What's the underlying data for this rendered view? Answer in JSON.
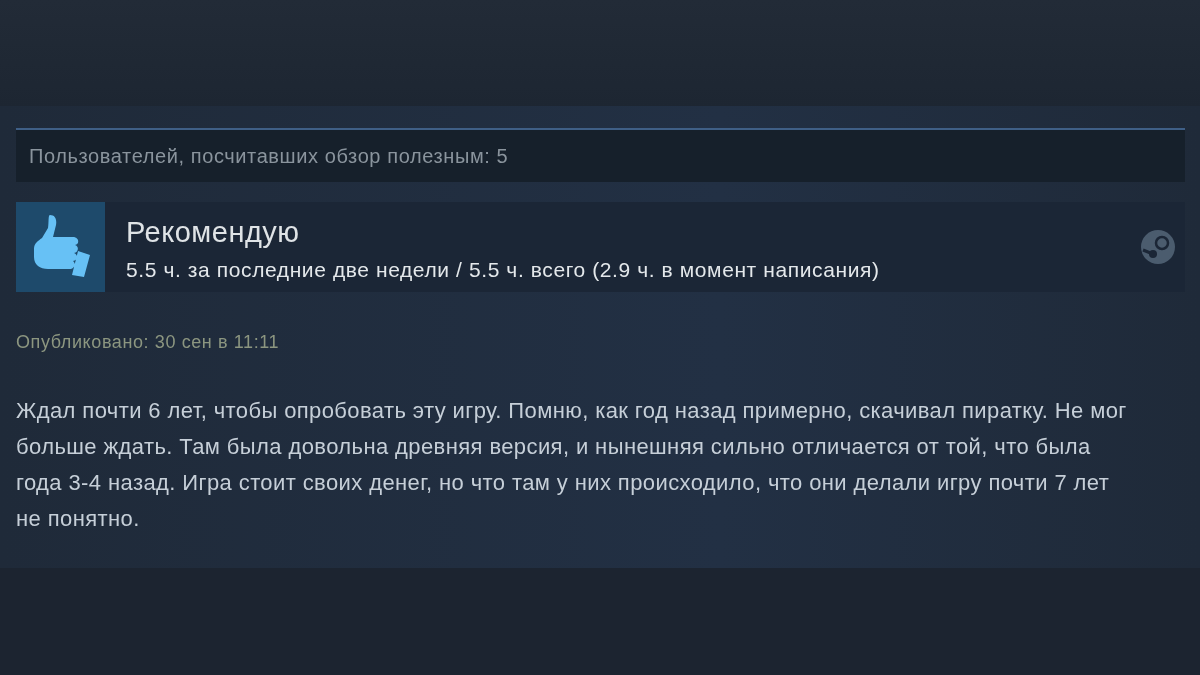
{
  "review": {
    "helpful": "Пользователей, посчитавших обзор полезным: 5",
    "verdict": "Рекомендую",
    "hours": "5.5 ч. за последние две недели / 5.5 ч. всего (2.9 ч. в момент написания)",
    "posted": "Опубликовано: 30 сен в 11:11",
    "body": "Ждал почти 6 лет, чтобы опробовать эту игру. Помню, как год назад примерно, скачивал пиратку. Не мог больше ждать. Там была довольна древняя версия, и нынешняя сильно отличается от той, что была года 3-4 назад. Игра стоит своих денег, но что там у них происходило, что они делали игру почти 7 лет не понятно."
  }
}
